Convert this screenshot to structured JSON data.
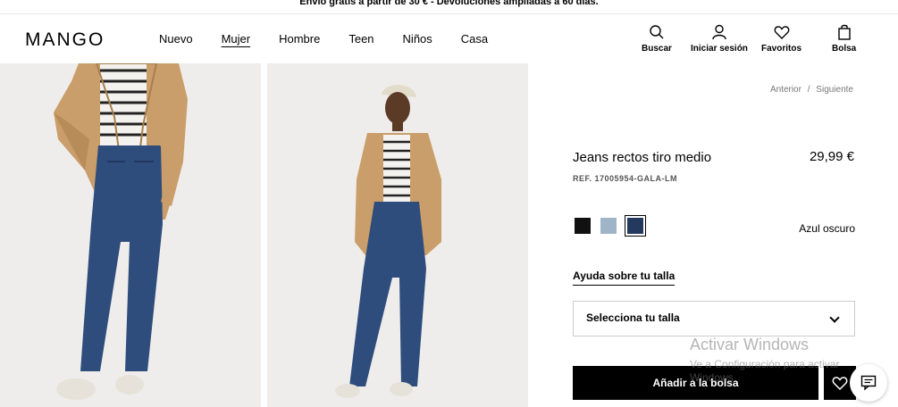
{
  "promo": {
    "text": "Envío gratis a partir de 30 € - Devoluciones ampliadas a 60 días."
  },
  "header": {
    "logo": "MANGO",
    "nav": [
      "Nuevo",
      "Mujer",
      "Hombre",
      "Teen",
      "Niños",
      "Casa"
    ],
    "active_nav": "Mujer",
    "tools": {
      "search": "Buscar",
      "login": "Iniciar sesión",
      "favorites": "Favoritos",
      "bag": "Bolsa"
    }
  },
  "pager": {
    "prev": "Anterior",
    "sep": "/",
    "next": "Siguiente"
  },
  "product": {
    "title": "Jeans rectos tiro medio",
    "price": "29,99 €",
    "ref": "REF. 17005954-GALA-LM",
    "colors": [
      "#111111",
      "#9fb4c6",
      "#23395d"
    ],
    "selected_color": "Azul oscuro",
    "size_help": "Ayuda sobre tu talla",
    "size_placeholder": "Selecciona tu talla",
    "add_to_bag": "Añadir a la bolsa"
  },
  "watermark": {
    "title": "Activar Windows",
    "subtitle": "Ve a Configuración para activar Windows."
  }
}
